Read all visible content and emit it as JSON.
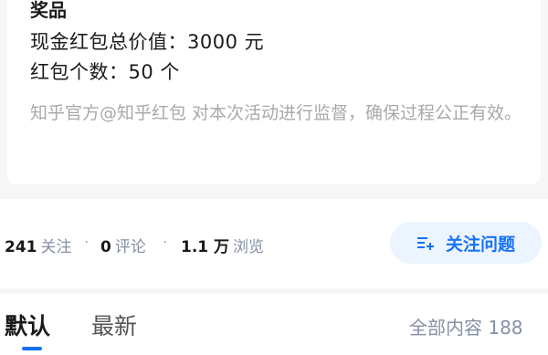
{
  "prize_card": {
    "title": "奖品",
    "total_value": "现金红包总价值：3000 元",
    "count": "红包个数：50 个",
    "notice": "知乎官方@知乎红包 对本次活动进行监督，确保过程公正有效。"
  },
  "stats": {
    "follow_count": "241",
    "follow_label": "关注",
    "comment_count": "0",
    "comment_label": "评论",
    "view_count": "1.1 万",
    "view_label": "浏览",
    "separator": "·"
  },
  "follow_button": {
    "label": "关注问题",
    "icon": "follow-question-icon"
  },
  "tabs": {
    "default_label": "默认",
    "latest_label": "最新",
    "total_label": "全部内容 188"
  },
  "colors": {
    "accent": "#1772f6",
    "button_bg": "#ebf4ff",
    "muted_text": "#8590a6"
  }
}
